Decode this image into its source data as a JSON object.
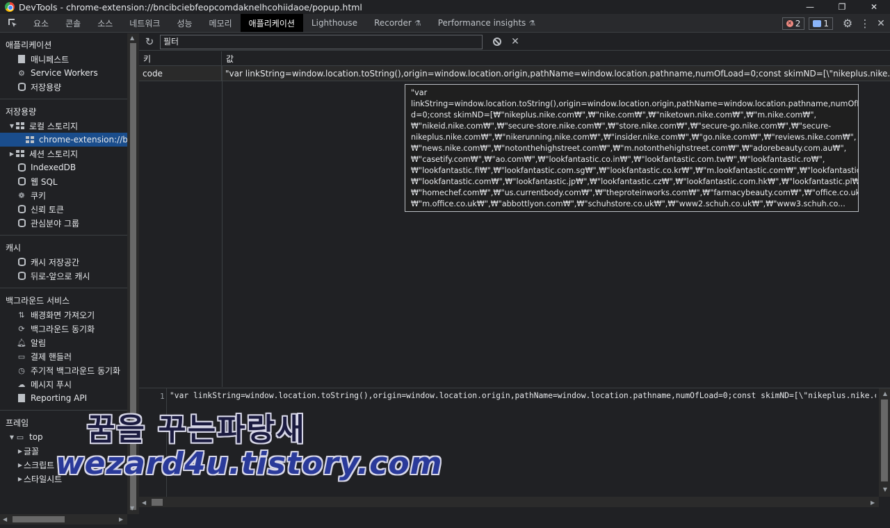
{
  "window": {
    "title": "DevTools - chrome-extension://bncibciebfeopcomdaknelhcohiidaoe/popup.html",
    "minimize": "—",
    "restore": "❐",
    "close": "✕"
  },
  "tabs": [
    {
      "label": "요소"
    },
    {
      "label": "콘솔"
    },
    {
      "label": "소스"
    },
    {
      "label": "네트워크"
    },
    {
      "label": "성능"
    },
    {
      "label": "메모리"
    },
    {
      "label": "애플리케이션",
      "active": true
    },
    {
      "label": "Lighthouse"
    },
    {
      "label": "Recorder"
    },
    {
      "label": "Performance insights"
    }
  ],
  "badges": {
    "errors": "2",
    "messages": "1"
  },
  "sidebar": {
    "application": {
      "title": "애플리케이션",
      "items": [
        "매니페스트",
        "Service Workers",
        "저장용량"
      ]
    },
    "storage": {
      "title": "저장용량",
      "local_storage": "로컬 스토리지",
      "local_origin": "chrome-extension://bnc",
      "session_storage": "세션 스토리지",
      "indexeddb": "IndexedDB",
      "websql": "웹 SQL",
      "cookies": "쿠키",
      "trust_tokens": "신뢰 토큰",
      "interest_groups": "관심분야 그룹"
    },
    "cache": {
      "title": "캐시",
      "items": [
        "캐시 저장공간",
        "뒤로-앞으로 캐시"
      ]
    },
    "background": {
      "title": "백그라운드 서비스",
      "items": [
        "배경화면 가져오기",
        "백그라운드 동기화",
        "알림",
        "결제 핸들러",
        "주기적 백그라운드 동기화",
        "메시지 푸시",
        "Reporting API"
      ]
    },
    "frames": {
      "title": "프레임",
      "top": "top",
      "items": [
        "글꼴",
        "스크립트",
        "스타일시트"
      ]
    }
  },
  "toolbar": {
    "filter_placeholder": "필터"
  },
  "table": {
    "columns": [
      "키",
      "값"
    ],
    "rows": [
      {
        "key": "code",
        "value": "\"var linkString=window.location.toString(),origin=window.location.origin,pathName=window.location.pathname,numOfLoad=0;const skimND=[\\\"nikeplus.nike.com\\\",\\\"nike.com\\\",\\\"niketown.nike.com\\\""
      }
    ]
  },
  "tooltip": {
    "lines": [
      "\"var",
      "linkString=window.location.toString(),origin=window.location.origin,pathName=window.location.pathname,numOfLoa",
      "d=0;const skimND=[₩\"nikeplus.nike.com₩\",₩\"nike.com₩\",₩\"niketown.nike.com₩\",₩\"m.nike.com₩\",",
      "₩\"nikeid.nike.com₩\",₩\"secure-store.nike.com₩\",₩\"store.nike.com₩\",₩\"secure-go.nike.com₩\",₩\"secure-",
      "nikeplus.nike.com₩\",₩\"nikerunning.nike.com₩\",₩\"insider.nike.com₩\",₩\"go.nike.com₩\",₩\"reviews.nike.com₩\",",
      "₩\"news.nike.com₩\",₩\"notonthehighstreet.com₩\",₩\"m.notonthehighstreet.com₩\",₩\"adorebeauty.com.au₩\",",
      "₩\"casetify.com₩\",₩\"ao.com₩\",₩\"lookfantastic.co.in₩\",₩\"lookfantastic.com.tw₩\",₩\"lookfantastic.ro₩\",",
      "₩\"lookfantastic.fi₩\",₩\"lookfantastic.com.sg₩\",₩\"lookfantastic.co.kr₩\",₩\"m.lookfantastic.com₩\",₩\"lookfantastic.gr₩\",",
      "₩\"lookfantastic.com₩\",₩\"lookfantastic.jp₩\",₩\"lookfantastic.cz₩\",₩\"lookfantastic.com.hk₩\",₩\"lookfantastic.pl₩\",",
      "₩\"homechef.com₩\",₩\"us.currentbody.com₩\",₩\"theproteinworks.com₩\",₩\"farmacybeauty.com₩\",₩\"office.co.uk₩\",",
      "₩\"m.office.co.uk₩\",₩\"abbottlyon.com₩\",₩\"schuhstore.co.uk₩\",₩\"www2.schuh.co.uk₩\",₩\"www3.schuh.co..."
    ]
  },
  "editor": {
    "line_number": "1",
    "code": "\"var linkString=window.location.toString(),origin=window.location.origin,pathName=window.location.pathname,numOfLoad=0;const skimND=[\\\"nikeplus.nike.com\\\",\\\"nike.com\\\""
  },
  "watermark": {
    "line1": "꿈을 꾸는파랑새",
    "line2": "wezard4u.tistory.com"
  }
}
